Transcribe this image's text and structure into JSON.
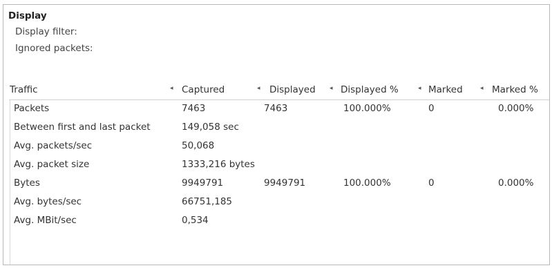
{
  "section": {
    "title": "Display",
    "display_filter_label": "Display filter:",
    "ignored_packets_label": "Ignored packets:"
  },
  "table": {
    "headers": [
      "Traffic",
      "Captured",
      "Displayed",
      "Displayed %",
      "Marked",
      "Marked %"
    ],
    "rows": [
      [
        "Packets",
        "7463",
        "7463",
        "100.000%",
        "0",
        "0.000%"
      ],
      [
        "Between first and last packet",
        "149,058 sec",
        "",
        "",
        "",
        ""
      ],
      [
        "Avg. packets/sec",
        "50,068",
        "",
        "",
        "",
        ""
      ],
      [
        "Avg. packet size",
        "1333,216 bytes",
        "",
        "",
        "",
        ""
      ],
      [
        "Bytes",
        "9949791",
        "9949791",
        "100.000%",
        "0",
        "0.000%"
      ],
      [
        "Avg. bytes/sec",
        "66751,185",
        "",
        "",
        "",
        ""
      ],
      [
        "Avg. MBit/sec",
        "0,534",
        "",
        "",
        "",
        ""
      ]
    ]
  },
  "icons": {
    "sort_arrow": "◂"
  }
}
